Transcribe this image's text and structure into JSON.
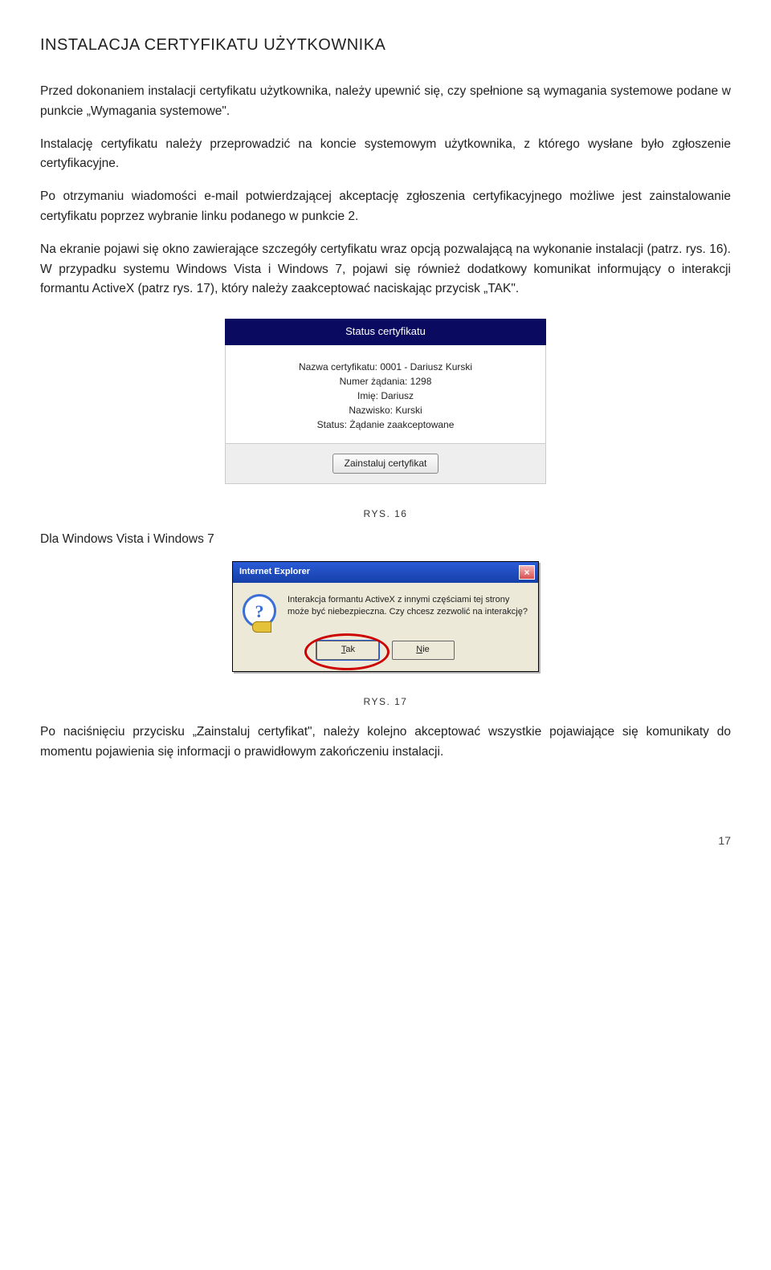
{
  "heading": "INSTALACJA CERTYFIKATU UŻYTKOWNIKA",
  "para1": "Przed dokonaniem instalacji certyfikatu użytkownika, należy upewnić się, czy spełnione są wymagania systemowe podane w punkcie „Wymagania systemowe\".",
  "para2": "Instalację certyfikatu należy przeprowadzić na koncie systemowym użytkownika, z którego wysłane było zgłoszenie certyfikacyjne.",
  "para3": "Po otrzymaniu wiadomości e-mail potwierdzającej akceptację zgłoszenia certyfikacyjnego możliwe jest zainstalowanie certyfikatu poprzez wybranie linku podanego w punkcie 2.",
  "para4": "Na ekranie pojawi się okno zawierające szczegóły certyfikatu wraz opcją pozwalającą na wykonanie instalacji (patrz. rys. 16). W przypadku systemu Windows Vista i Windows 7, pojawi się również dodatkowy komunikat informujący o interakcji formantu ActiveX (patrz rys. 17), który należy zaakceptować naciskając przycisk „TAK\".",
  "cert_panel": {
    "title": "Status certyfikatu",
    "line_name": "Nazwa certyfikatu: 0001 - Dariusz Kurski",
    "line_req": "Numer żądania: 1298",
    "line_first": "Imię: Dariusz",
    "line_last": "Nazwisko: Kurski",
    "line_status": "Status: Żądanie zaakceptowane",
    "install_btn": "Zainstaluj certyfikat"
  },
  "fig16": "RYS. 16",
  "vista_heading": "Dla Windows Vista i Windows 7",
  "ie_dialog": {
    "title": "Internet Explorer",
    "message": "Interakcja formantu ActiveX z innymi częściami tej strony może być niebezpieczna. Czy chcesz zezwolić na interakcję?",
    "btn_yes": "Tak",
    "btn_no": "Nie",
    "close_glyph": "×"
  },
  "fig17": "RYS. 17",
  "para5": "Po naciśnięciu przycisku „Zainstaluj certyfikat\", należy kolejno akceptować wszystkie pojawiające się komunikaty do momentu pojawienia się informacji o prawidłowym zakończeniu instalacji.",
  "page_number": "17"
}
